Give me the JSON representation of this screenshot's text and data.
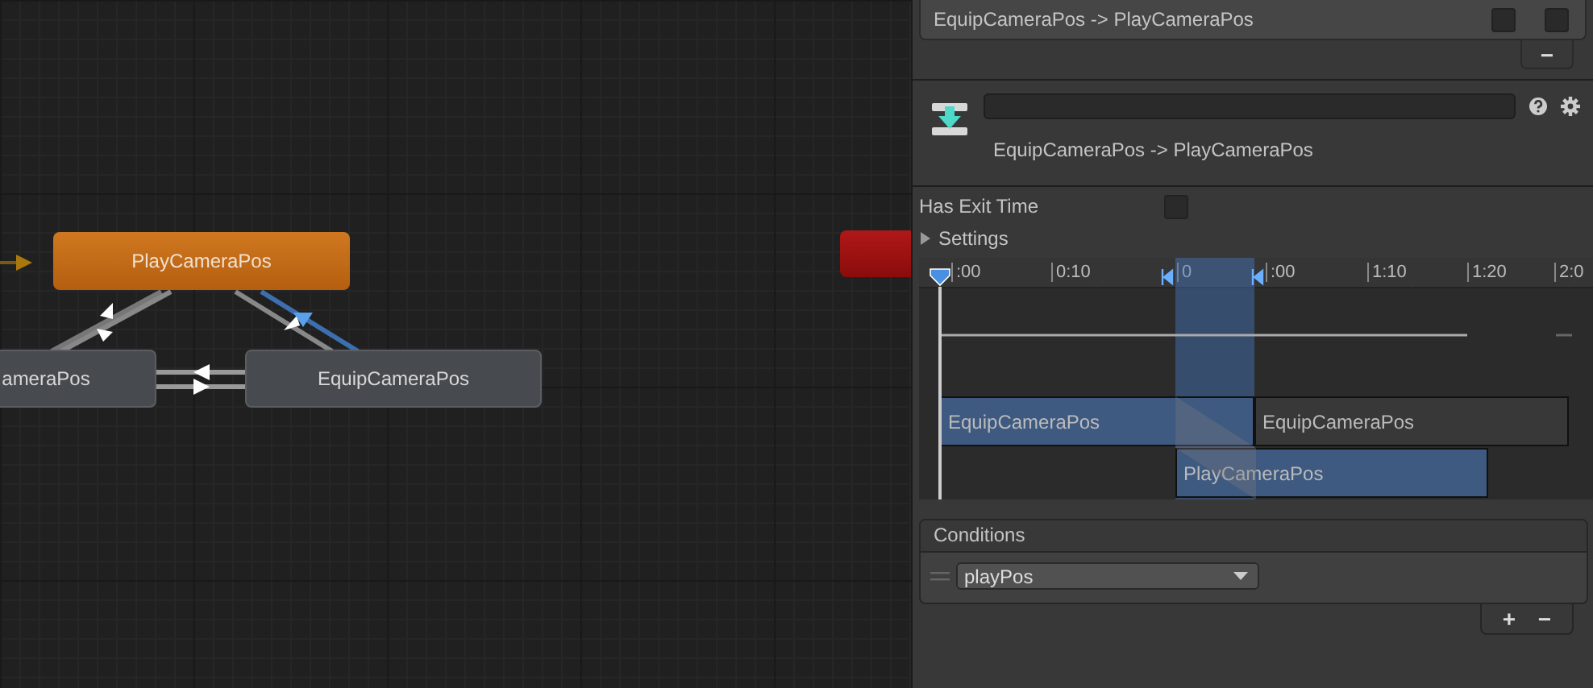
{
  "graph": {
    "nodes": [
      {
        "label": "PlayCameraPos",
        "kind": "default"
      },
      {
        "label": "ameraPos",
        "kind": "normal"
      },
      {
        "label": "EquipCameraPos",
        "kind": "normal"
      },
      {
        "kind": "any"
      }
    ]
  },
  "inspector": {
    "transitions": [
      {
        "label": "EquipCameraPos -> PlayCameraPos",
        "solo": false,
        "mute": false
      }
    ],
    "list_remove": "−",
    "title": "EquipCameraPos -> PlayCameraPos",
    "has_exit_time": {
      "label": "Has Exit Time",
      "checked": false
    },
    "settings": {
      "label": "Settings",
      "expanded": false
    },
    "timeline": {
      "ticks": [
        ":00",
        "0:10",
        "0",
        ":00",
        "1:10",
        "1:20",
        "2:0"
      ],
      "clips": [
        {
          "label": "EquipCameraPos",
          "kind": "source"
        },
        {
          "label": "EquipCameraPos",
          "kind": "source_next"
        },
        {
          "label": "PlayCameraPos",
          "kind": "target"
        }
      ]
    },
    "conditions": {
      "title": "Conditions",
      "items": [
        {
          "parameter": "playPos"
        }
      ],
      "add": "+",
      "remove": "−"
    }
  }
}
